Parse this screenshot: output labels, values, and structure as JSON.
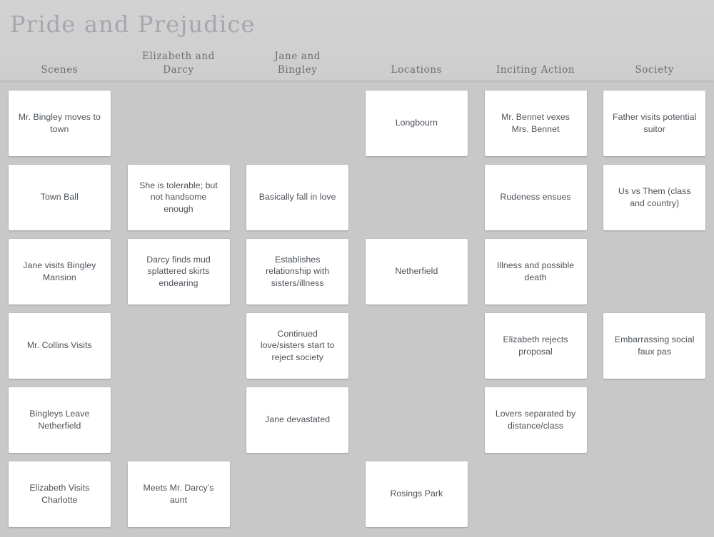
{
  "board": {
    "title": "Pride and Prejudice",
    "background_color": "#c8c8c8",
    "header_bar_color": "#d0d0d0",
    "card_color": "#ffffff",
    "card_text_color": "#4c5258",
    "title_color": "#a9a5ae",
    "header_label_color": "#6e6a72"
  },
  "columns": [
    {
      "header": "Scenes",
      "cards": [
        "Mr. Bingley moves to town",
        "Town Ball",
        "Jane visits Bingley Mansion",
        "Mr. Collins Visits",
        "Bingleys Leave Netherfield",
        "Elizabeth Visits Charlotte"
      ]
    },
    {
      "header": "Elizabeth and Darcy",
      "cards": [
        "",
        "She is tolerable; but not handsome enough",
        "Darcy finds mud splattered skirts endearing",
        "",
        "",
        "Meets Mr. Darcy’s aunt"
      ]
    },
    {
      "header": "Jane and Bingley",
      "cards": [
        "",
        "Basically fall in love",
        "Establishes relationship with sisters/illness",
        "Continued love/sisters start to reject society",
        "Jane devastated",
        ""
      ]
    },
    {
      "header": "Locations",
      "cards": [
        "Longbourn",
        "",
        "Netherfield",
        "",
        "",
        "Rosings Park"
      ]
    },
    {
      "header": "Inciting Action",
      "cards": [
        "Mr. Bennet vexes Mrs. Bennet",
        "Rudeness ensues",
        "Illness and possible death",
        "Elizabeth rejects proposal",
        "Lovers separated by distance/class",
        ""
      ]
    },
    {
      "header": "Society",
      "cards": [
        "Father visits potential suitor",
        "Us vs Them (class and country)",
        "",
        "Embarrassing social faux pas",
        "",
        ""
      ]
    }
  ]
}
